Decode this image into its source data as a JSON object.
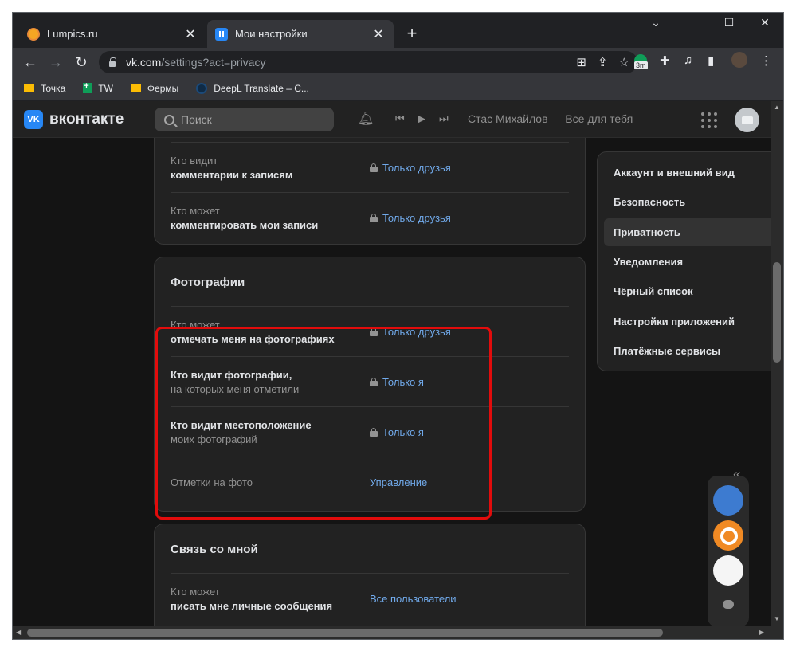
{
  "browser": {
    "tabs": [
      {
        "title": "Lumpics.ru",
        "close": "✕"
      },
      {
        "title": "Мои настройки",
        "close": "✕"
      }
    ],
    "new_tab": "+",
    "window_controls": {
      "collapse_tabs": "⌄",
      "minimize": "—",
      "maximize": "☐",
      "close": "✕"
    },
    "nav": {
      "back": "←",
      "forward": "→",
      "reload": "↻"
    },
    "url_host": "vk.com",
    "url_path": "/settings?act=privacy",
    "extension_badge": "3m",
    "bookmarks": [
      {
        "label": "Точка",
        "icon": "folder-icon"
      },
      {
        "label": "TW",
        "icon": "sheets-icon"
      },
      {
        "label": "Фермы",
        "icon": "folder-icon"
      },
      {
        "label": "DeepL Translate – С...",
        "icon": "deepl-icon"
      }
    ]
  },
  "vk": {
    "logo_text": "вконтакте",
    "logo_mark": "VK",
    "search_placeholder": "Поиск",
    "now_playing": "Стас Михайлов — Все для тебя",
    "cards": {
      "wall": {
        "rows": [
          {
            "label_line1": "Кто видит",
            "label_line2": "комментарии к записям",
            "value": "Только друзья",
            "locked": true
          },
          {
            "label_line1": "Кто может",
            "label_line2": "комментировать мои записи",
            "value": "Только друзья",
            "locked": true
          }
        ]
      },
      "photos": {
        "title": "Фотографии",
        "rows": [
          {
            "label_line1": "Кто может",
            "label_line2": "отмечать меня на фотографиях",
            "value": "Только друзья",
            "locked": true
          },
          {
            "label_line1": "Кто видит фотографии,",
            "label_line2": "на которых меня отметили",
            "value": "Только я",
            "locked": true
          },
          {
            "label_line1": "Кто видит местоположение",
            "label_line2": "моих фотографий",
            "value": "Только я",
            "locked": true
          },
          {
            "label_line1": "Отметки на фото",
            "label_line2": "",
            "value": "Управление",
            "locked": false
          }
        ]
      },
      "contact": {
        "title": "Связь со мной",
        "rows": [
          {
            "label_line1": "Кто может",
            "label_line2": "писать мне личные сообщения",
            "value": "Все пользователи",
            "locked": false
          }
        ]
      }
    },
    "settings_menu": [
      "Аккаунт и внешний вид",
      "Безопасность",
      "Приватность",
      "Уведомления",
      "Чёрный список",
      "Настройки приложений",
      "Платёжные сервисы"
    ],
    "settings_menu_selected": "Приватность",
    "collapse_symbol": "«",
    "colors": {
      "accent_link": "#71aaeb",
      "highlight": "#e20c0c",
      "background": "#141414",
      "card": "#222222"
    }
  }
}
